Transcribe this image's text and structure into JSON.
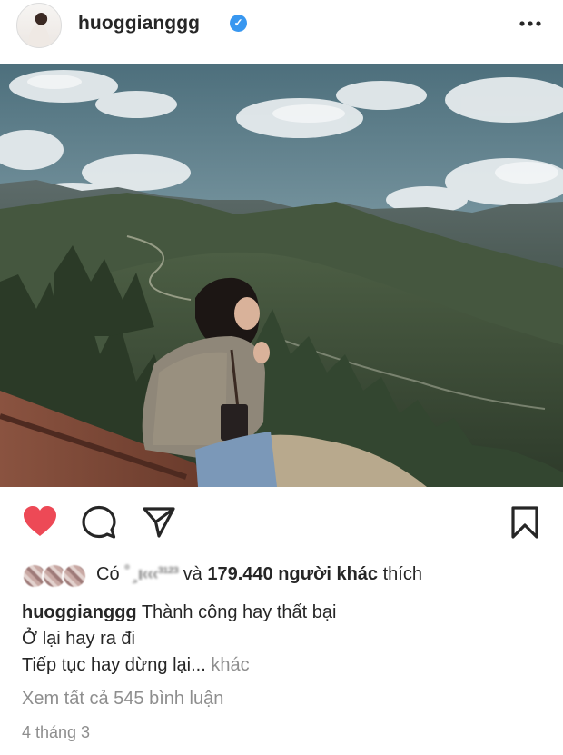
{
  "header": {
    "username": "huoggianggg",
    "verified_mark": "✓",
    "more_icon": "more-horizontal-icon"
  },
  "photo": {
    "description_icon": "post-photo"
  },
  "actions": {
    "like_icon": "heart-filled-icon",
    "comment_icon": "comment-icon",
    "share_icon": "share-icon",
    "save_icon": "bookmark-icon",
    "like_color": "#ed4956"
  },
  "likes": {
    "prefix": "Có",
    "blurred_name": "˚ ̧ ı‹‹‹³¹²³",
    "middle": "và",
    "count_text": "179.440 người khác",
    "suffix": "thích"
  },
  "caption": {
    "username": "huoggianggg",
    "line1": "Thành công hay thất bại",
    "line2": "Ở lại hay ra đi",
    "line3": "Tiếp tục hay dừng lại...",
    "more": "khác"
  },
  "comments_link": "Xem tất cả 545 bình luận",
  "date": "4 tháng 3"
}
